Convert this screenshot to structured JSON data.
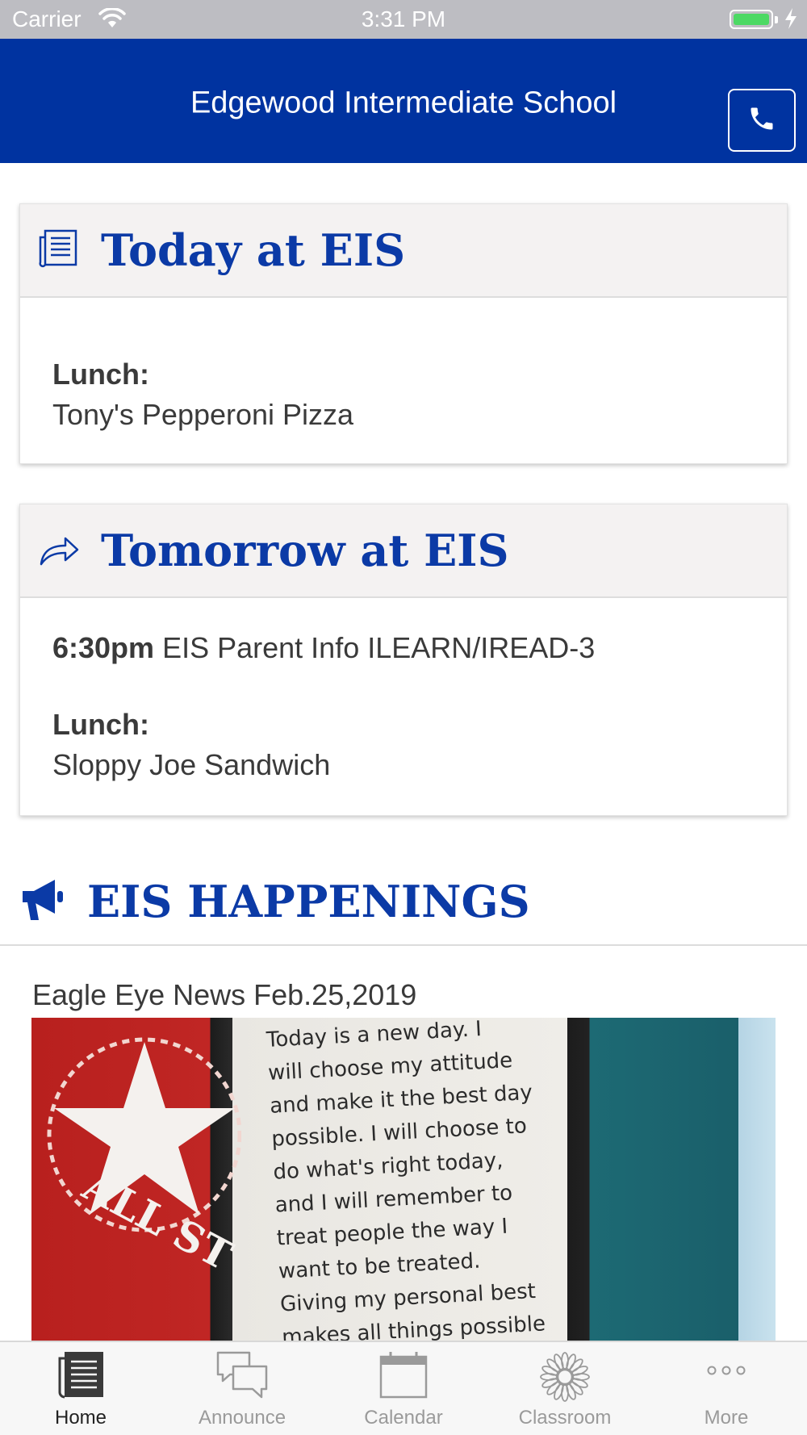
{
  "status_bar": {
    "carrier": "Carrier",
    "time": "3:31 PM",
    "battery_level": 1.0
  },
  "header": {
    "title": "Edgewood Intermediate School",
    "phone_button_icon": "phone-icon",
    "background_color": "#0033a0"
  },
  "today": {
    "title": "Today at EIS",
    "icon": "newspaper-icon",
    "lunch_label": "Lunch:",
    "lunch_value": "Tony's Pepperoni Pizza"
  },
  "tomorrow": {
    "title": "Tomorrow at EIS",
    "icon": "share-arrow-icon",
    "event_time": "6:30pm",
    "event_title": "EIS Parent Info ILEARN/IREAD-3",
    "lunch_label": "Lunch:",
    "lunch_value": "Sloppy Joe Sandwich"
  },
  "happenings": {
    "title": "EIS HAPPENINGS",
    "icon": "megaphone-icon",
    "news_title": "Eagle Eye News Feb.25,2019",
    "image_text": [
      "Today is a new day. I",
      "will choose my attitude",
      "and make it the best day",
      "possible. I will choose to",
      "do what's right today,",
      "and I will remember to",
      "treat people the way I",
      "want to be treated.",
      "Giving my personal best",
      "makes all things possible"
    ],
    "image_shirt_text": "ALL ST"
  },
  "tabs": [
    {
      "label": "Home",
      "icon": "home-list-icon",
      "active": true
    },
    {
      "label": "Announce",
      "icon": "chat-bubbles-icon",
      "active": false
    },
    {
      "label": "Calendar",
      "icon": "calendar-icon",
      "active": false
    },
    {
      "label": "Classroom",
      "icon": "flower-icon",
      "active": false
    },
    {
      "label": "More",
      "icon": "more-dots-icon",
      "active": false
    }
  ],
  "colors": {
    "accent": "#0b3aa6",
    "card_header_bg": "#f4f2f2"
  }
}
